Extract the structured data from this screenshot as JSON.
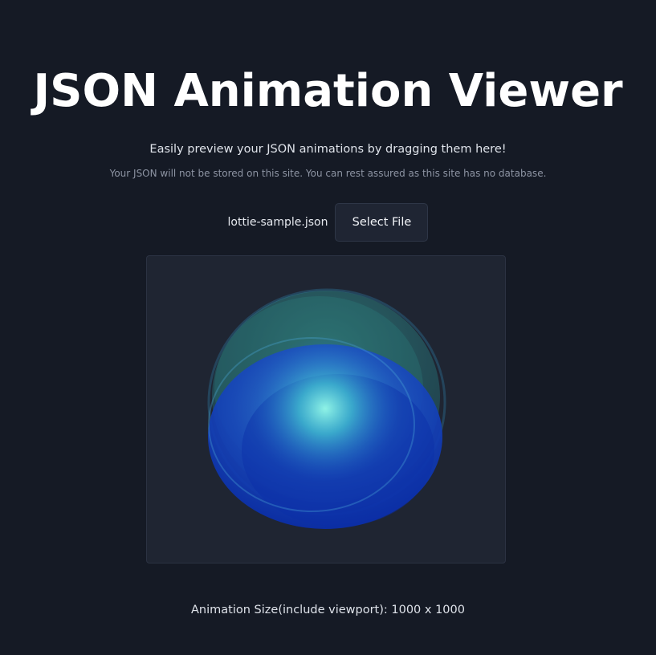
{
  "header": {
    "title": "JSON Animation Viewer",
    "subtitle": "Easily preview your JSON animations by dragging them here!",
    "note": "Your JSON will not be stored on this site. You can rest assured as this site has no database."
  },
  "file_picker": {
    "file_name": "lottie-sample.json",
    "select_label": "Select File"
  },
  "animation": {
    "colors": {
      "center_glow": "#8ff3e6",
      "mid": "#2f8fd6",
      "deep_blue": "#0a2ea8",
      "outer_teal": "#2e8a8a"
    }
  },
  "footer": {
    "size_info": "Animation Size(include viewport): 1000 x 1000"
  }
}
